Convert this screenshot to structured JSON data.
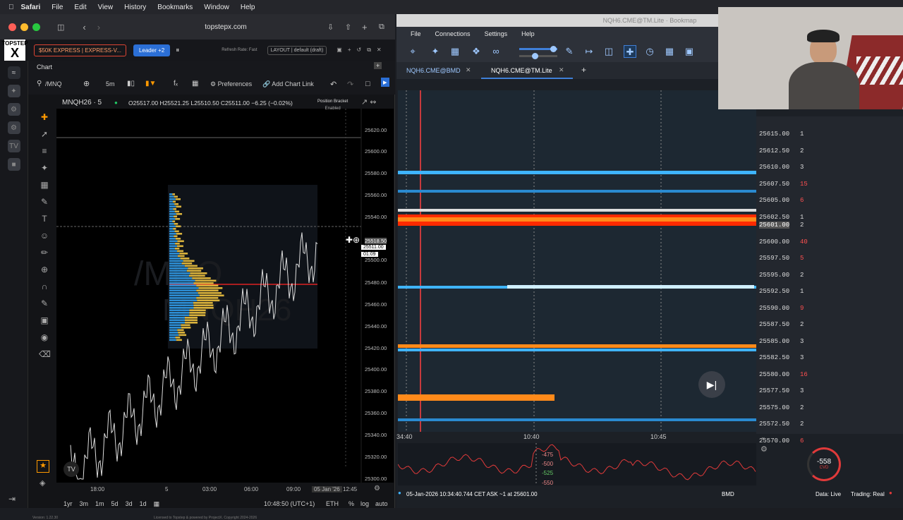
{
  "menubar": {
    "app": "Safari",
    "items": [
      "File",
      "Edit",
      "View",
      "History",
      "Bookmarks",
      "Window",
      "Help"
    ]
  },
  "browser": {
    "url": "topstepx.com"
  },
  "topstep": {
    "logo_top": "TOPSTEP",
    "logo_mark": "X",
    "account": "$50K EXPRESS | EXPRESS-V...",
    "leader": "Leader +2",
    "refresh": "Refresh Rate: Fast",
    "layout": "LAYOUT | default (draft)"
  },
  "chart": {
    "tab": "Chart",
    "symbol": "/MNQ",
    "interval": "5m",
    "preferences": "Preferences",
    "add_link": "Add Chart Link",
    "title": "MNQH26 · 5",
    "ohlc": "O25517.00 H25521.25 L25510.50 C25511.00 −6.25 (−0.02%)",
    "bracket": "Position Bracket",
    "bracket_state": "Enabled",
    "watermark1": "/MNQ",
    "watermark2": "MNQH26",
    "yticks": [
      "25620.00",
      "25600.00",
      "25580.00",
      "25560.00",
      "25540.00",
      "25518.50",
      "25500.00",
      "25480.00",
      "25460.00",
      "25440.00",
      "25420.00",
      "25400.00",
      "25380.00",
      "25360.00",
      "25340.00",
      "25320.00",
      "25300.00"
    ],
    "price_label": "25511.00",
    "countdown": "01:09",
    "xticks": [
      "18:00",
      "5",
      "03:00",
      "06:00",
      "09:00",
      "05 Jan '26",
      "12:45"
    ],
    "ranges": [
      "1yr",
      "3m",
      "1m",
      "5d",
      "3d",
      "1d"
    ],
    "time": "10:48:50 (UTC+1)",
    "session": "ETH",
    "pct": "%",
    "log": "log",
    "auto": "auto",
    "footer_left": "Version: 1.22.30",
    "footer_right": "Licensed to Topstep & powered by ProjectX. Copyright 2024-2026"
  },
  "bookmap": {
    "title": "NQH6.CME@TM.Lite · Bookmap",
    "menu": [
      "File",
      "Connections",
      "Settings",
      "Help"
    ],
    "tabs": [
      "NQH6.CME@BMD",
      "NQH6.CME@TM.Lite"
    ],
    "prices": [
      "25615.00",
      "25612.50",
      "25610.00",
      "25607.50",
      "25605.00",
      "25602.50",
      "25601.00",
      "25600.00",
      "25597.50",
      "25595.00",
      "25592.50",
      "25590.00",
      "25587.50",
      "25585.00",
      "25582.50",
      "25580.00",
      "25577.50",
      "25575.00",
      "25572.50",
      "25570.00"
    ],
    "sizes": [
      "1",
      "2",
      "3",
      "15",
      "6",
      "1",
      "2",
      "40",
      "5",
      "2",
      "1",
      "9",
      "2",
      "3",
      "3",
      "16",
      "3",
      "2",
      "2",
      "6"
    ],
    "times": [
      "34:40",
      "10:40",
      "10:45"
    ],
    "cvd_ticks": [
      "-475",
      "-500",
      "-525",
      "-550"
    ],
    "cvd_value": "-558",
    "cvd_label": "CVD",
    "status": "05-Jan-2026 10:34:40.744 CET   ASK ~1 at 25601.00",
    "feed": "BMD",
    "data": "Data: Live",
    "trading": "Trading: Real"
  },
  "colors": {
    "heat_red": "#ff2a00",
    "heat_orange": "#ff8a1a",
    "heat_blue": "#3fb4ff",
    "accent": "#2b6fd6"
  }
}
